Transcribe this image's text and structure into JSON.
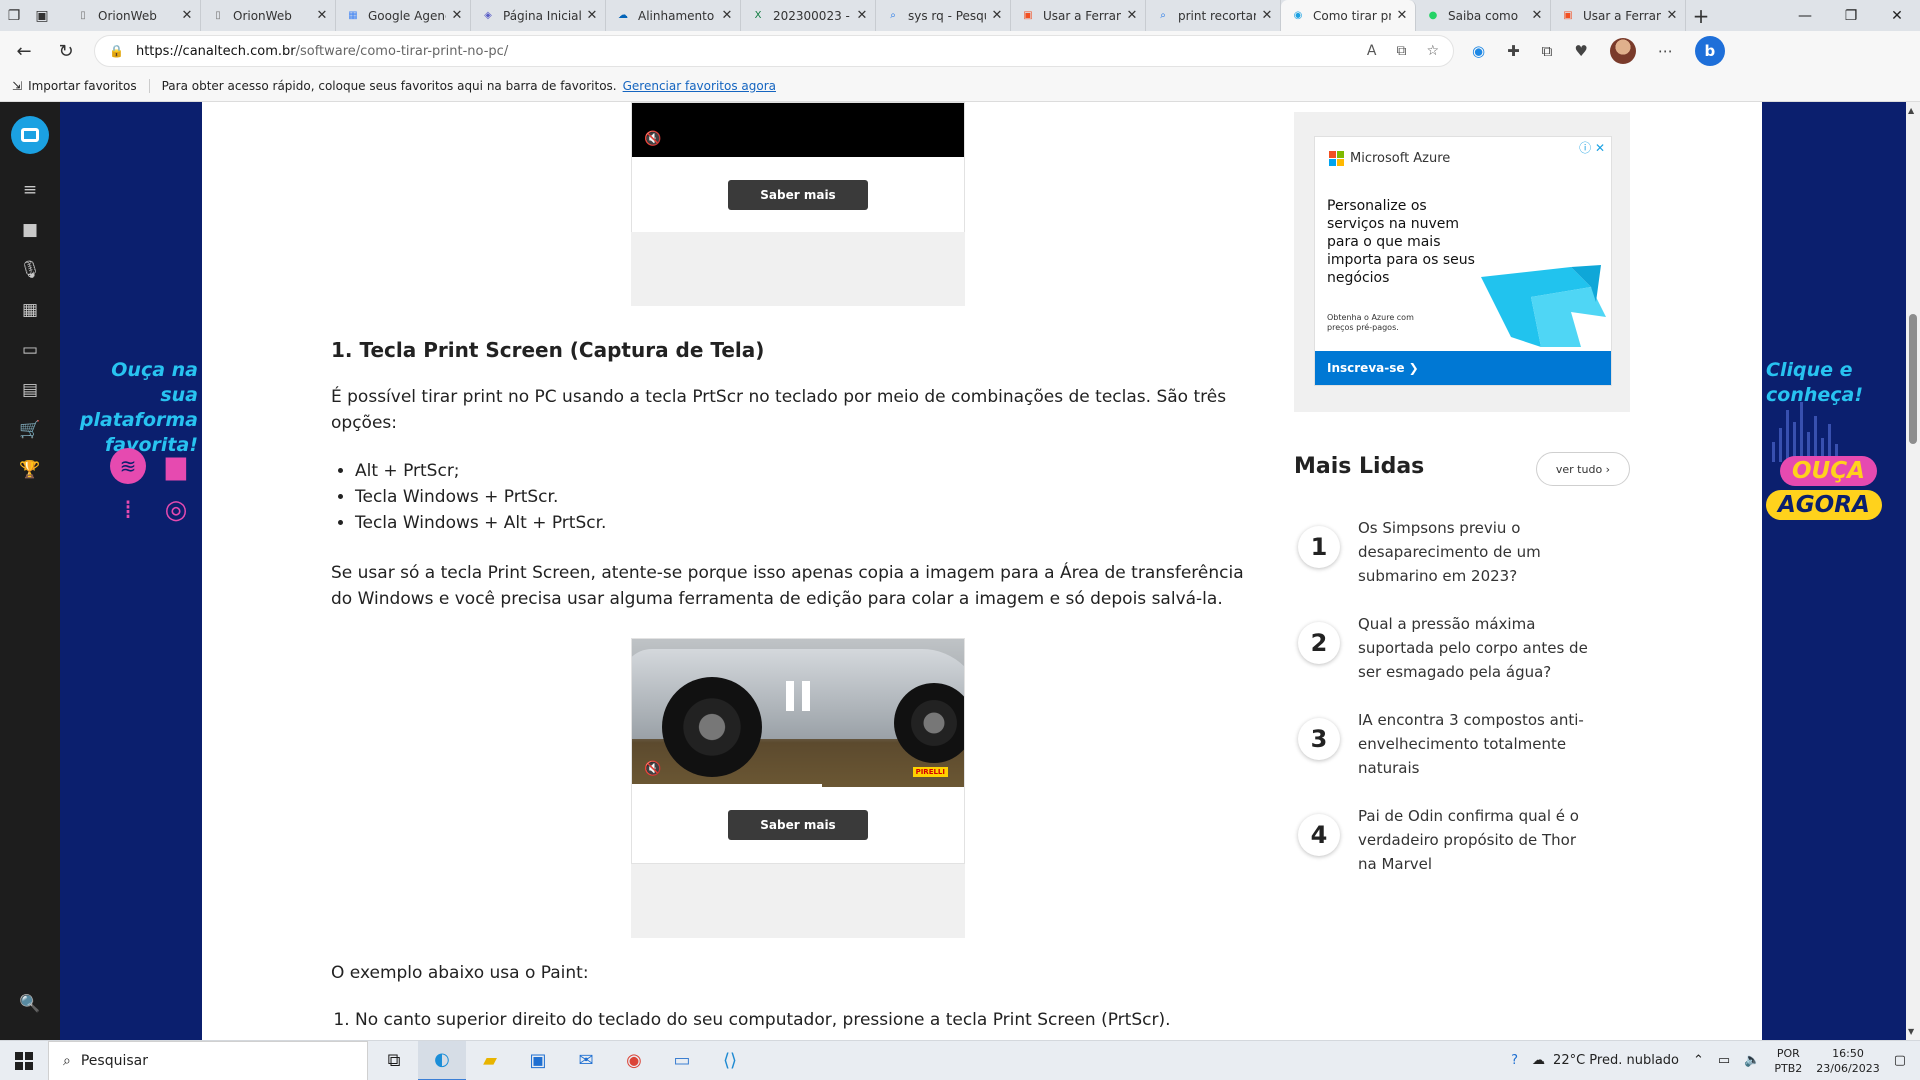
{
  "browser": {
    "tabs": [
      {
        "title": "OrionWeb",
        "icon": "page-icon",
        "color": "#777777"
      },
      {
        "title": "OrionWeb",
        "icon": "page-icon",
        "color": "#777777"
      },
      {
        "title": "Google Agenda",
        "icon": "google-icon",
        "color": "#4285f4"
      },
      {
        "title": "Página Inicial",
        "icon": "teams-icon",
        "color": "#5b5fc7"
      },
      {
        "title": "Alinhamento",
        "icon": "onedrive-icon",
        "color": "#0364b8"
      },
      {
        "title": "202300023 -",
        "icon": "excel-icon",
        "color": "#107c41"
      },
      {
        "title": "sys rq - Pesquisa",
        "icon": "search-icon",
        "color": "#1a73e8"
      },
      {
        "title": "Usar a Ferramenta",
        "icon": "microsoft-icon",
        "color": "#f25022"
      },
      {
        "title": "print recortar",
        "icon": "search-icon",
        "color": "#1a73e8"
      },
      {
        "title": "Como tirar print",
        "icon": "canaltech-icon",
        "color": "#1ba1e2"
      },
      {
        "title": "Saiba como",
        "icon": "whatsapp-icon",
        "color": "#25d366"
      },
      {
        "title": "Usar a Ferramenta",
        "icon": "microsoft-icon",
        "color": "#f25022"
      }
    ],
    "url_host": "https://canaltech.com.br",
    "url_path": "/software/como-tirar-print-no-pc/",
    "favorites": {
      "import_label": "Importar favoritos",
      "message": "Para obter acesso rápido, coloque seus favoritos aqui na barra de favoritos.",
      "manage_link": "Gerenciar favoritos agora"
    }
  },
  "side_banner": {
    "left_text": "Ouça na sua plataforma favorita!",
    "right_text": "Clique e conheça!",
    "ouca": "OUÇA",
    "agora": "AGORA"
  },
  "article": {
    "video_cta": "Saber mais",
    "heading": "1. Tecla Print Screen (Captura de Tela)",
    "intro": "É possível tirar print no PC usando a tecla PrtScr no teclado por meio de combinações de teclas. São três opções:",
    "bullets": [
      "Alt + PrtScr;",
      "Tecla Windows + PrtScr.",
      "Tecla Windows + Alt + PrtScr."
    ],
    "para2": "Se usar só a tecla Print Screen, atente-se porque isso apenas copia a imagem para a Área de transferência do Windows e você precisa usar alguma ferramenta de edição para colar a imagem e só depois salvá-la.",
    "brand_badge": "PIRELLI",
    "para3": "O exemplo abaixo usa o Paint:",
    "steps": [
      "No canto superior direito do teclado do seu computador, pressione a tecla Print Screen (PrtScr)."
    ]
  },
  "sidebar": {
    "ad": {
      "brand": "Microsoft Azure",
      "headline": "Personalize os serviços na nuvem para o que mais importa para os seus negócios",
      "small": "Obtenha o Azure com preços pré-pagos.",
      "cta": "Inscreva-se ❯"
    },
    "mais_lidas_title": "Mais Lidas",
    "ver_tudo": "ver tudo ›",
    "items": [
      {
        "n": "1",
        "text": "Os Simpsons previu o desaparecimento de um submarino em 2023?"
      },
      {
        "n": "2",
        "text": "Qual a pressão máxima suportada pelo corpo antes de ser esmagado pela água?"
      },
      {
        "n": "3",
        "text": "IA encontra 3 compostos anti-envelhecimento totalmente naturais"
      },
      {
        "n": "4",
        "text": "Pai de Odin confirma qual é o verdadeiro propósito de Thor na Marvel"
      }
    ]
  },
  "taskbar": {
    "search_placeholder": "Pesquisar",
    "weather": "22°C  Pred. nublado",
    "lang1": "POR",
    "lang2": "PTB2",
    "time": "16:50",
    "date": "23/06/2023"
  }
}
